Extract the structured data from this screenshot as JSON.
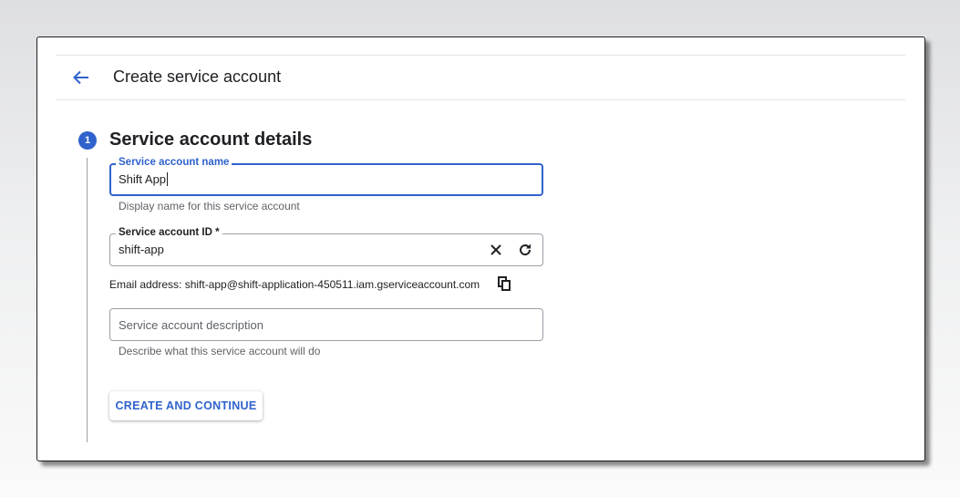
{
  "header": {
    "back_icon": "arrow-left-icon",
    "title": "Create service account"
  },
  "step": {
    "number": "1",
    "title": "Service account details"
  },
  "form": {
    "name": {
      "label": "Service account name",
      "value": "Shift App",
      "hint": "Display name for this service account",
      "focused": true
    },
    "id": {
      "label": "Service account ID *",
      "value": "shift-app",
      "clear_icon": "close-icon",
      "refresh_icon": "refresh-icon"
    },
    "email": {
      "text": "Email address: shift-app@shift-application-450511.iam.gserviceaccount.com",
      "copy_icon": "copy-icon"
    },
    "description": {
      "placeholder": "Service account description",
      "value": "",
      "hint": "Describe what this service account will do"
    }
  },
  "actions": {
    "primary_label": "CREATE AND CONTINUE"
  },
  "colors": {
    "accent": "#2f62cc",
    "text": "#202124",
    "muted": "#5f6368"
  }
}
